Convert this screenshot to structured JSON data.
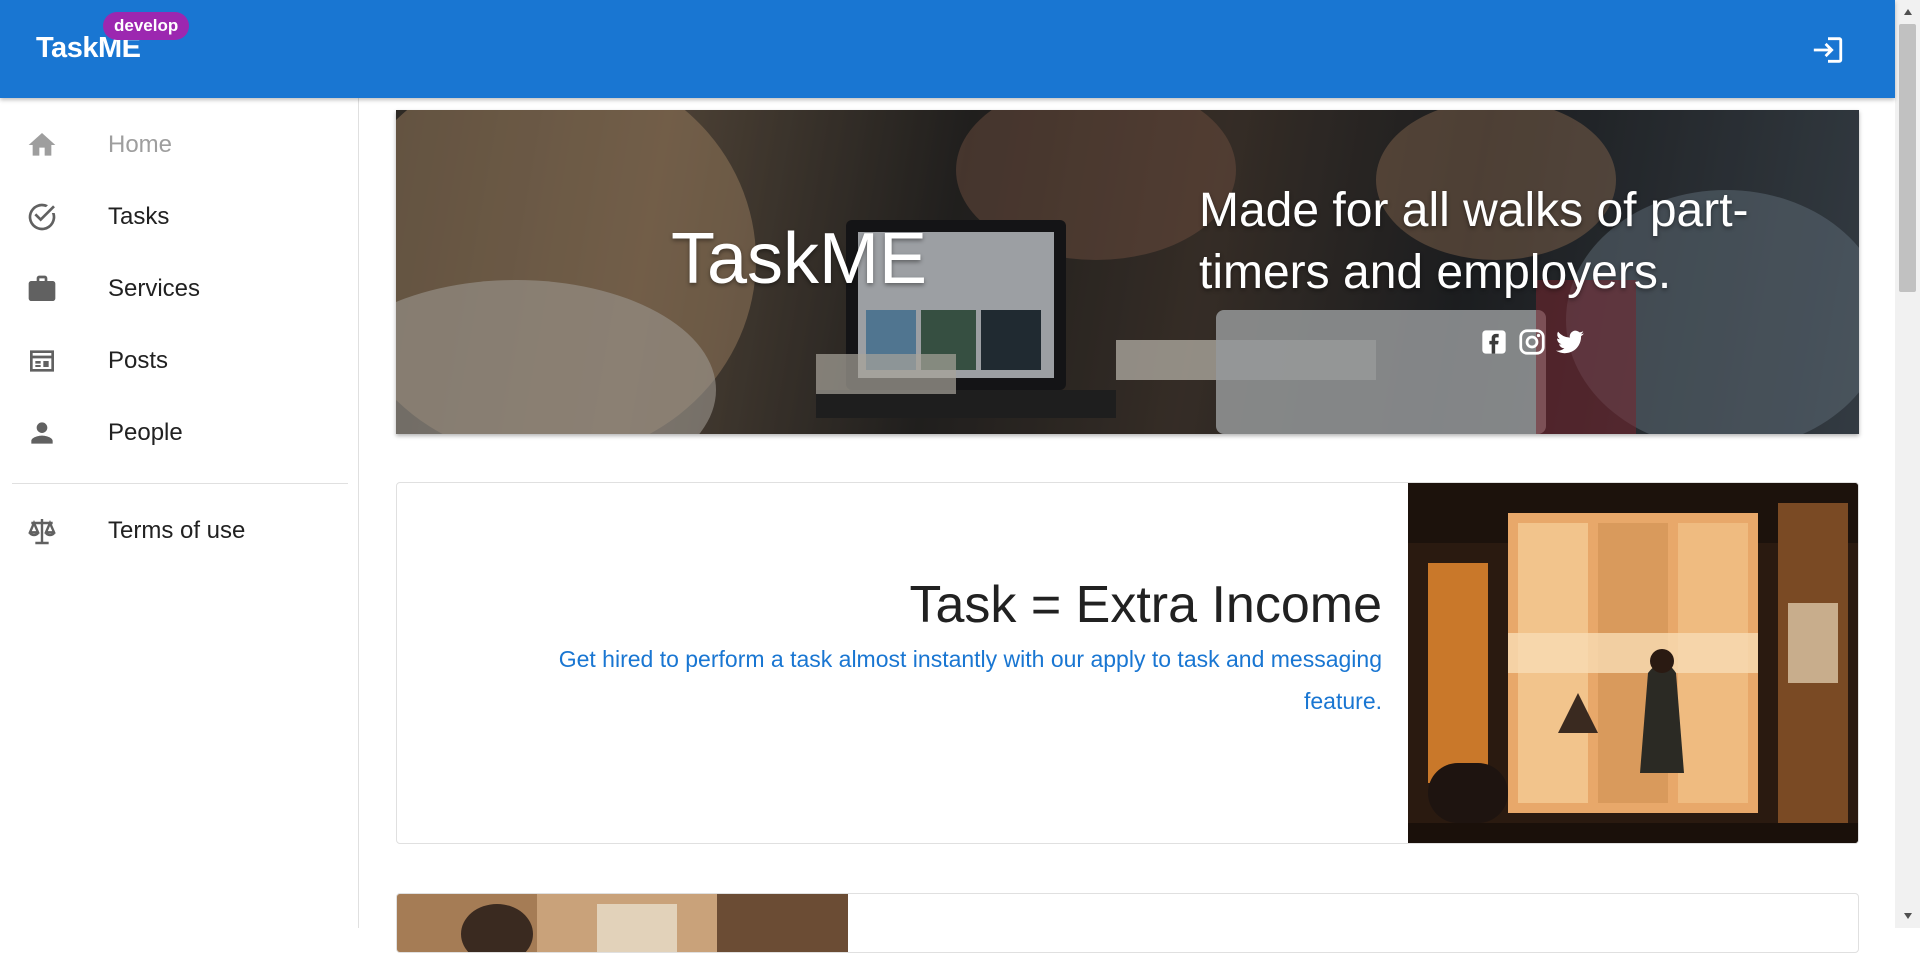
{
  "appbar": {
    "brand": "TaskME",
    "env_badge": "develop",
    "login_icon": "login-icon"
  },
  "sidebar": {
    "items": [
      {
        "label": "Home",
        "icon": "home-icon",
        "disabled": true
      },
      {
        "label": "Tasks",
        "icon": "check-circle-icon"
      },
      {
        "label": "Services",
        "icon": "briefcase-icon"
      },
      {
        "label": "Posts",
        "icon": "newspaper-icon"
      },
      {
        "label": "People",
        "icon": "person-icon"
      }
    ],
    "footer_items": [
      {
        "label": "Terms of use",
        "icon": "scale-icon"
      }
    ]
  },
  "hero": {
    "title": "TaskME",
    "tagline": "Made for all walks of part-timers and employers.",
    "socials": [
      "facebook-icon",
      "instagram-icon",
      "twitter-icon"
    ]
  },
  "feature_card": {
    "title": "Task = Extra Income",
    "description": "Get hired to perform a task almost instantly with our apply to task and messaging feature."
  },
  "colors": {
    "primary": "#1976d2",
    "badge": "#9c27b0",
    "muted": "#9e9e9e"
  }
}
